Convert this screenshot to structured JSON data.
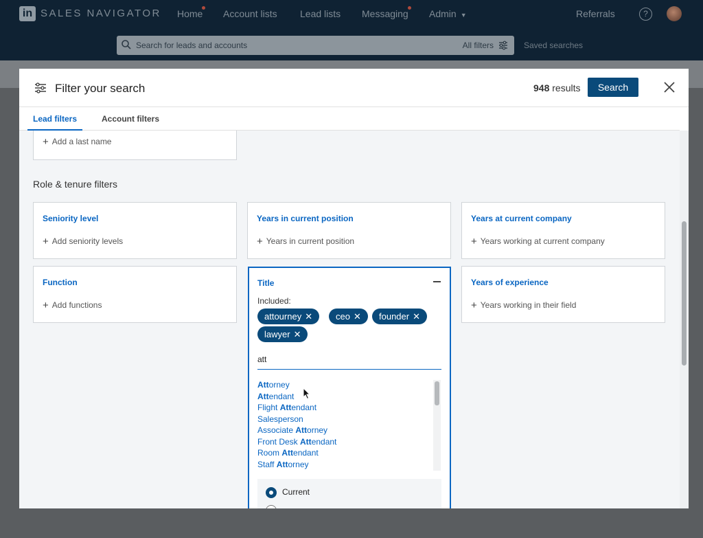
{
  "nav": {
    "logo": "in",
    "brand": "SALES NAVIGATOR",
    "items": [
      "Home",
      "Account lists",
      "Lead lists",
      "Messaging",
      "Admin"
    ],
    "referrals": "Referrals",
    "search_placeholder": "Search for leads and accounts",
    "all_filters": "All filters",
    "saved_searches": "Saved searches"
  },
  "modal": {
    "title": "Filter your search",
    "results_count": "948",
    "results_label": "results",
    "search_button": "Search",
    "tabs": [
      "Lead filters",
      "Account filters"
    ],
    "last_name_add": "Add a last name",
    "section_title": "Role & tenure filters",
    "cards": {
      "seniority": {
        "title": "Seniority level",
        "add": "Add seniority levels"
      },
      "years_position": {
        "title": "Years in current position",
        "add": "Years in current position"
      },
      "years_company": {
        "title": "Years at current company",
        "add": "Years working at current company"
      },
      "function": {
        "title": "Function",
        "add": "Add functions"
      },
      "years_experience": {
        "title": "Years of experience",
        "add": "Years working in their field"
      }
    },
    "title_filter": {
      "title": "Title",
      "included_label": "Included:",
      "pills": [
        "attourney",
        "ceo",
        "founder",
        "lawyer"
      ],
      "input_value": "att",
      "suggestions": [
        {
          "bold": "Att",
          "rest": "orney"
        },
        {
          "bold": "Att",
          "rest": "endant"
        },
        {
          "pre": "Flight ",
          "bold": "Att",
          "rest": "endant"
        },
        {
          "pre": "Salesperson",
          "bold": "",
          "rest": ""
        },
        {
          "pre": "Associate ",
          "bold": "Att",
          "rest": "orney"
        },
        {
          "pre": "Front Desk ",
          "bold": "Att",
          "rest": "endant"
        },
        {
          "pre": "Room ",
          "bold": "Att",
          "rest": "endant"
        },
        {
          "pre": "Staff ",
          "bold": "Att",
          "rest": "orney"
        }
      ],
      "radio_current": "Current"
    }
  }
}
